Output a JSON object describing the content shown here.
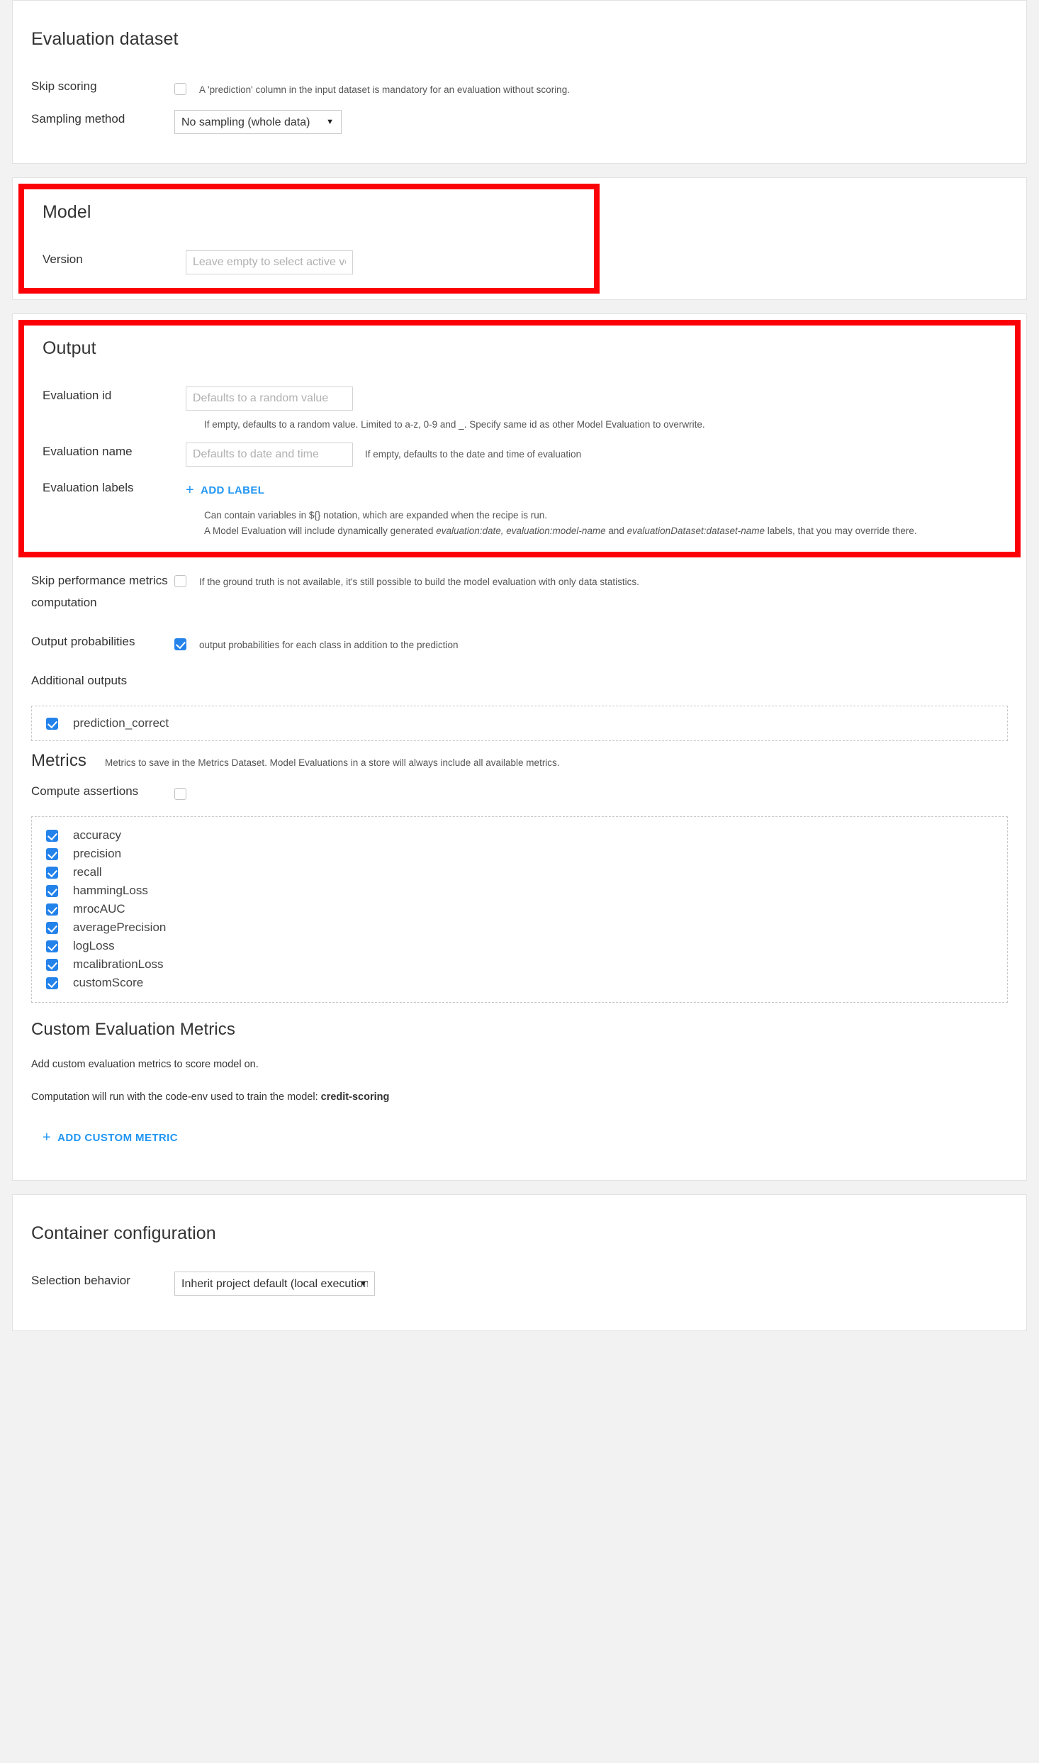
{
  "sections": {
    "evaluation_dataset": {
      "title": "Evaluation dataset",
      "skip_scoring": {
        "label": "Skip scoring",
        "checked": false,
        "help": "A 'prediction' column in the input dataset is mandatory for an evaluation without scoring."
      },
      "sampling_method": {
        "label": "Sampling method",
        "value": "No sampling (whole data)",
        "options": [
          "No sampling (whole data)"
        ]
      }
    },
    "model": {
      "title": "Model",
      "highlighted": true,
      "version": {
        "label": "Version",
        "value": "",
        "placeholder": "Leave empty to select active version"
      }
    },
    "output": {
      "title": "Output",
      "highlighted": true,
      "evaluation_id": {
        "label": "Evaluation id",
        "value": "",
        "placeholder": "Defaults to a random value",
        "help": "If empty, defaults to a random value. Limited to a-z, 0-9 and _. Specify same id as other Model Evaluation to overwrite."
      },
      "evaluation_name": {
        "label": "Evaluation name",
        "value": "",
        "placeholder": "Defaults to date and time",
        "hint_inline": "If empty, defaults to the date and time of evaluation"
      },
      "evaluation_labels": {
        "label": "Evaluation labels",
        "add_label_button": "ADD LABEL",
        "hint_1": "Can contain variables in ${} notation, which are expanded when the recipe is run.",
        "hint_2_pre": "A Model Evaluation will include dynamically generated ",
        "hint_2_em1": "evaluation:date, evaluation:model-name",
        "hint_2_mid": " and ",
        "hint_2_em2": "evaluationDataset:dataset-name",
        "hint_2_post": " labels, that you may override there."
      },
      "skip_performance_metrics": {
        "label": "Skip performance metrics computation",
        "checked": false,
        "help": "If the ground truth is not available, it's still possible to build the model evaluation with only data statistics."
      },
      "output_probabilities": {
        "label": "Output probabilities",
        "checked": true,
        "help": "output probabilities for each class in addition to the prediction"
      },
      "additional_outputs": {
        "label": "Additional outputs",
        "options": [
          {
            "label": "prediction_correct",
            "checked": true
          }
        ]
      }
    },
    "metrics": {
      "title": "Metrics",
      "note": "Metrics to save in the Metrics Dataset. Model Evaluations in a store will always include all available metrics.",
      "compute_assertions": {
        "label": "Compute assertions",
        "checked": false
      },
      "options": [
        {
          "label": "accuracy",
          "checked": true
        },
        {
          "label": "precision",
          "checked": true
        },
        {
          "label": "recall",
          "checked": true
        },
        {
          "label": "hammingLoss",
          "checked": true
        },
        {
          "label": "mrocAUC",
          "checked": true
        },
        {
          "label": "averagePrecision",
          "checked": true
        },
        {
          "label": "logLoss",
          "checked": true
        },
        {
          "label": "mcalibrationLoss",
          "checked": true
        },
        {
          "label": "customScore",
          "checked": true
        }
      ]
    },
    "custom_evaluation_metrics": {
      "title": "Custom Evaluation Metrics",
      "para_1": "Add custom evaluation metrics to score model on.",
      "para_2_pre": "Computation will run with the code-env used to train the model: ",
      "para_2_bold": "credit-scoring",
      "add_button": "ADD CUSTOM METRIC"
    },
    "container_configuration": {
      "title": "Container configuration",
      "selection_behavior": {
        "label": "Selection behavior",
        "value": "Inherit project default (local execution)",
        "options": [
          "Inherit project default (local execution)"
        ]
      }
    }
  },
  "icons": {
    "plus": "+",
    "caret_down": "▼"
  },
  "colors": {
    "accent": "#2196f3",
    "checkbox_checked": "#2483eb",
    "highlight_border": "#fb0007",
    "page_background": "#f2f2f2",
    "panel_background": "#ffffff"
  }
}
